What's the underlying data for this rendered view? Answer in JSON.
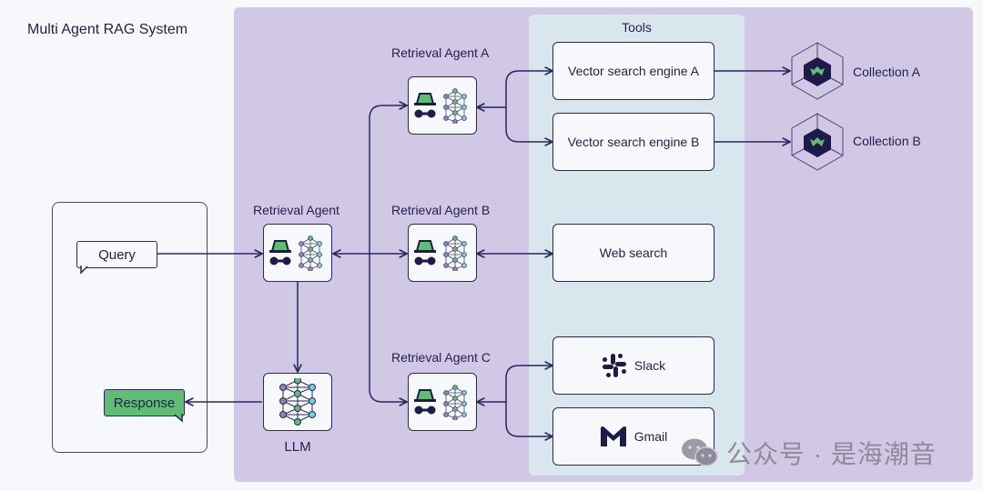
{
  "title": "Multi Agent RAG System",
  "tools_label": "Tools",
  "user": {
    "query": "Query",
    "response": "Response"
  },
  "orchestrator": {
    "label": "Retrieval Agent",
    "icon": "spy-agent-with-neural-net-icon"
  },
  "llm": {
    "label": "LLM",
    "icon": "neural-network-icon"
  },
  "agents": [
    {
      "label": "Retrieval Agent A",
      "icon": "spy-agent-with-neural-net-icon"
    },
    {
      "label": "Retrieval Agent B",
      "icon": "spy-agent-with-neural-net-icon"
    },
    {
      "label": "Retrieval Agent C",
      "icon": "spy-agent-with-neural-net-icon"
    }
  ],
  "tools": [
    {
      "label": "Vector search engine A"
    },
    {
      "label": "Vector search engine B"
    },
    {
      "label": "Web search"
    },
    {
      "label": "Slack",
      "icon": "slack-icon"
    },
    {
      "label": "Gmail",
      "icon": "gmail-icon"
    }
  ],
  "collections": [
    {
      "label": "Collection A",
      "icon": "weaviate-cube-icon"
    },
    {
      "label": "Collection B",
      "icon": "weaviate-cube-icon"
    }
  ],
  "watermark": "公众号 · 是海潮音",
  "colors": {
    "agent_region": "#d1c8e6",
    "tools_region": "#d9e6ee",
    "ink": "#2b2760",
    "accent_green": "#5fbd74",
    "node_cyan": "#6fd0e6",
    "node_gray": "#8c87ae"
  }
}
